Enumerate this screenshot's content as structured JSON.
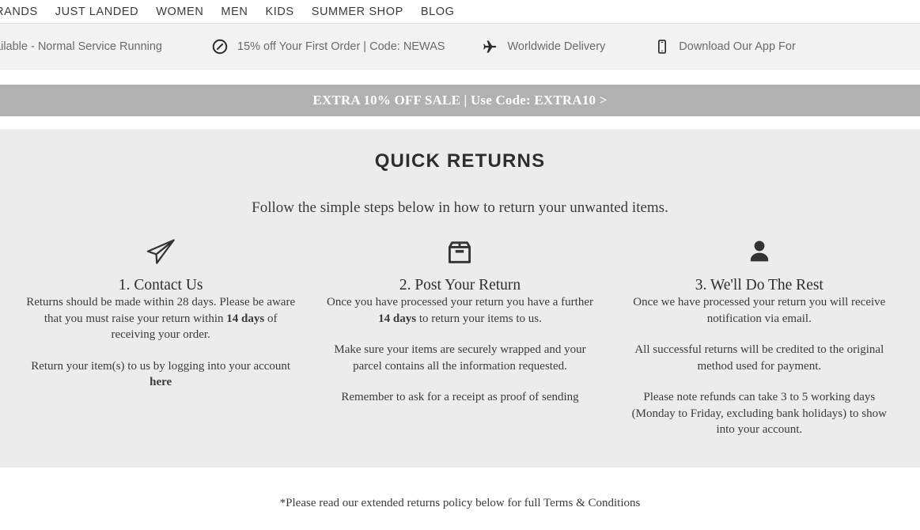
{
  "nav": {
    "items": [
      {
        "label": "RANDS",
        "name": "nav-item-brands"
      },
      {
        "label": "JUST LANDED",
        "name": "nav-item-just-landed"
      },
      {
        "label": "WOMEN",
        "name": "nav-item-women"
      },
      {
        "label": "MEN",
        "name": "nav-item-men"
      },
      {
        "label": "KIDS",
        "name": "nav-item-kids"
      },
      {
        "label": "SUMMER SHOP",
        "name": "nav-item-summer-shop"
      },
      {
        "label": "BLOG",
        "name": "nav-item-blog"
      }
    ]
  },
  "promo": {
    "items": [
      {
        "icon": "none",
        "text": "ery Available - Normal Service Running"
      },
      {
        "icon": "discount-icon",
        "text": "15% off Your First Order | Code: NEWAS"
      },
      {
        "icon": "airplane-icon",
        "text": "Worldwide Delivery"
      },
      {
        "icon": "mobile-phone-icon",
        "text": "Download Our App For"
      }
    ]
  },
  "sale_banner": {
    "text": "EXTRA 10% OFF SALE | Use Code: EXTRA10 >",
    "background": "#b1b1b1",
    "text_color": "#ffffff"
  },
  "returns": {
    "title": "QUICK RETURNS",
    "subtitle": "Follow the simple steps below in how to return your unwanted items.",
    "background": "#ececec",
    "steps": [
      {
        "icon": "paper-plane-icon",
        "title": "1. Contact Us",
        "paragraphs": [
          {
            "parts": [
              {
                "t": "Returns should be made within 28 days. Please be aware that you must raise your return within ",
                "b": false
              },
              {
                "t": "14 days",
                "b": true
              },
              {
                "t": " of receiving your order.",
                "b": false
              }
            ]
          },
          {
            "parts": [
              {
                "t": "Return your item(s) to us by logging into your account ",
                "b": false
              },
              {
                "t": "here",
                "b": true
              }
            ]
          }
        ]
      },
      {
        "icon": "box-icon",
        "title": "2. Post Your Return",
        "paragraphs": [
          {
            "parts": [
              {
                "t": "Once you have processed your return you have a further ",
                "b": false
              },
              {
                "t": "14 days",
                "b": true
              },
              {
                "t": " to return your items to us.",
                "b": false
              }
            ]
          },
          {
            "parts": [
              {
                "t": "Make sure your items are securely wrapped and your parcel contains all the information requested.",
                "b": false
              }
            ]
          },
          {
            "parts": [
              {
                "t": "Remember to ask for a receipt as proof of sending",
                "b": false
              }
            ]
          }
        ]
      },
      {
        "icon": "person-icon",
        "title": "3. We'll Do The Rest",
        "paragraphs": [
          {
            "parts": [
              {
                "t": "Once we have processed your return you will receive notification via email.",
                "b": false
              }
            ]
          },
          {
            "parts": [
              {
                "t": "All successful returns will be credited to the original method used for payment.",
                "b": false
              }
            ]
          },
          {
            "parts": [
              {
                "t": "Please note refunds can take 3 to 5 working days (Monday to Friday, excluding bank holidays) to show into your account.",
                "b": false
              }
            ]
          }
        ]
      }
    ]
  },
  "footer_note": "*Please read our extended returns policy below for full Terms & Conditions"
}
